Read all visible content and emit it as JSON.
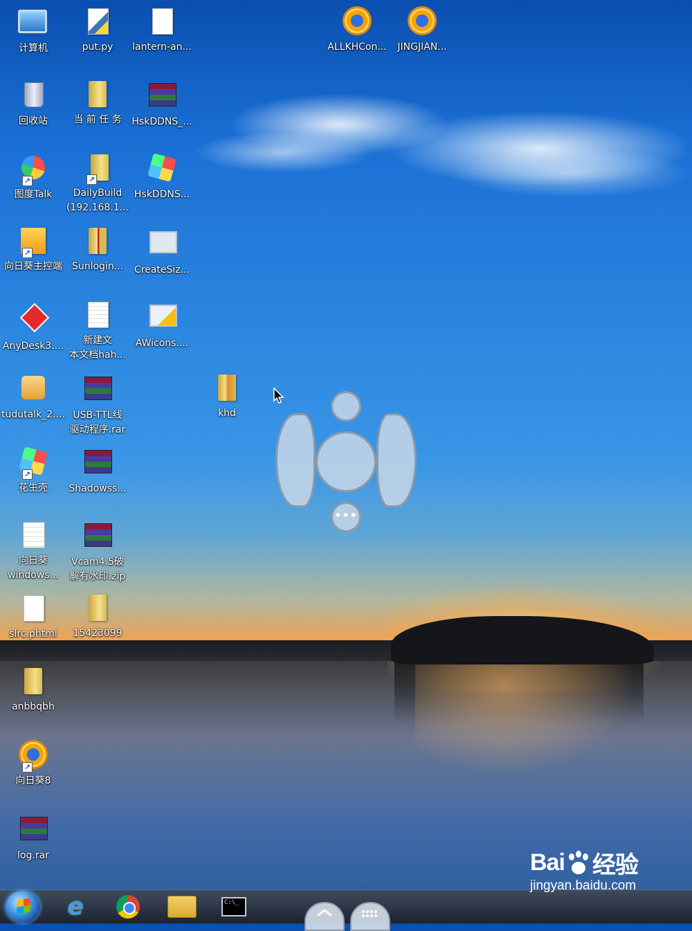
{
  "desktop_icons": {
    "computer": "计算机",
    "put_py": "put.py",
    "lantern": "lantern-an...",
    "allkh": "ALLKHCon...",
    "jingjian": "JINGJIAN...",
    "recycle": "回收站",
    "current_task": "当 前 任 务",
    "hskddns_rar": "HskDDNS_...",
    "dutalk": "图度Talk",
    "dailybuild": "DailyBuild\n(192.168.1...",
    "hskddns_app": "HskDDNS...",
    "sunflower_ctrl": "向日葵主控端",
    "sunlogin": "Sunlogin...",
    "createsiz": "CreateSiz...",
    "anydesk": "AnyDesk3....",
    "new_text": "新建文\n本文档hah...",
    "awicons": "AWicons....",
    "tudutalk": "tudutalk_2....",
    "usb_ttl": "USB-TTL线\n驱动程序.rar",
    "khd": "khd",
    "huashengke": "花生壳",
    "shadowss": "Shadowss...",
    "sunflower_win": "向日葵\nwindows...",
    "vcam": "Vcam4.5破\n解有水印.zip",
    "slrc": "slrc.phtml",
    "folder_15423099": "15423099",
    "anbbqbh": "anbbqbh",
    "sunflower8": "向日葵8",
    "log_rar": "log.rar"
  },
  "taskbar": {
    "cmd_glyph": "C:\\_"
  },
  "gesture": {
    "more_glyph": "•••"
  },
  "watermark": {
    "brand_left": "Bai",
    "brand_right": "经验",
    "url": "jingyan.baidu.com"
  },
  "colors": {
    "accent_blue": "#2b86e0",
    "sunset_orange": "#f0a24a"
  }
}
